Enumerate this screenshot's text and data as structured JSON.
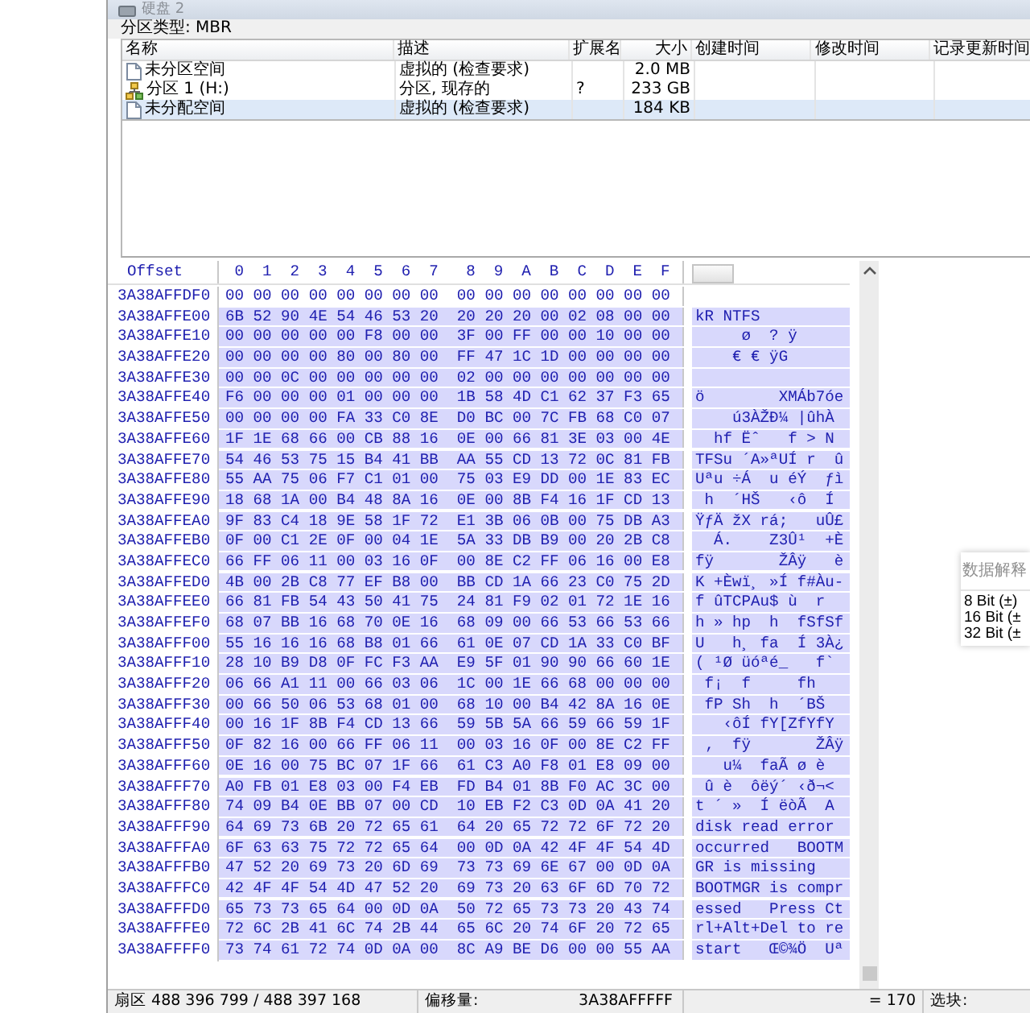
{
  "window": {
    "title": "硬盘 2"
  },
  "partition_type": "分区类型: MBR",
  "partitions": {
    "columns": [
      "名称",
      "描述",
      "扩展名",
      "大小",
      "创建时间",
      "修改时间",
      "记录更新时间"
    ],
    "rows": [
      {
        "kind": "file",
        "name": "未分区空间",
        "description": "虚拟的 (检查要求)",
        "size": "2.0 MB",
        "selected": false
      },
      {
        "kind": "partition",
        "name": "分区 1 (H:)",
        "description": "分区, 现存的",
        "extension": "?",
        "size": "233 GB",
        "selected": false
      },
      {
        "kind": "file",
        "name": "未分配空间",
        "description": "虚拟的 (检查要求)",
        "size": "184 KB",
        "selected": true
      }
    ]
  },
  "hex": {
    "offset_label": "Offset",
    "columns": [
      "0",
      "1",
      "2",
      "3",
      "4",
      "5",
      "6",
      "7",
      "8",
      "9",
      "A",
      "B",
      "C",
      "D",
      "E",
      "F"
    ],
    "rows": [
      {
        "offset": "3A38AFFDF0",
        "bytes": "00 00 00 00 00 00 00 00  00 00 00 00 00 00 00 00",
        "selected": false
      },
      {
        "offset": "3A38AFFE00",
        "bytes": "6B 52 90 4E 54 46 53 20  20 20 20 00 02 08 00 00",
        "text": "kR NTFS",
        "selected": true
      },
      {
        "offset": "3A38AFFE10",
        "bytes": "00 00 00 00 00 F8 00 00  3F 00 FF 00 00 10 00 00",
        "text": "     ø  ? ÿ",
        "selected": true
      },
      {
        "offset": "3A38AFFE20",
        "bytes": "00 00 00 00 80 00 80 00  FF 47 1C 1D 00 00 00 00",
        "text": "    € € ÿG",
        "selected": true
      },
      {
        "offset": "3A38AFFE30",
        "bytes": "00 00 0C 00 00 00 00 00  02 00 00 00 00 00 00 00",
        "selected": true
      },
      {
        "offset": "3A38AFFE40",
        "bytes": "F6 00 00 00 01 00 00 00  1B 58 4D C1 62 37 F3 65",
        "text": "ö        XMÁb7óe",
        "selected": true
      },
      {
        "offset": "3A38AFFE50",
        "bytes": "00 00 00 00 FA 33 C0 8E  D0 BC 00 7C FB 68 C0 07",
        "text": "    ú3ÀŽÐ¼ |ûhÀ",
        "selected": true
      },
      {
        "offset": "3A38AFFE60",
        "bytes": "1F 1E 68 66 00 CB 88 16  0E 00 66 81 3E 03 00 4E",
        "text": "  hf Ëˆ   f > N",
        "selected": true
      },
      {
        "offset": "3A38AFFE70",
        "bytes": "54 46 53 75 15 B4 41 BB  AA 55 CD 13 72 0C 81 FB",
        "text": "TFSu ´A»ªUÍ r  û",
        "selected": true
      },
      {
        "offset": "3A38AFFE80",
        "bytes": "55 AA 75 06 F7 C1 01 00  75 03 E9 DD 00 1E 83 EC",
        "text": "Uªu ÷Á  u éÝ  ƒì",
        "selected": true
      },
      {
        "offset": "3A38AFFE90",
        "bytes": "18 68 1A 00 B4 48 8A 16  0E 00 8B F4 16 1F CD 13",
        "text": " h  ´HŠ   ‹ô  Í",
        "selected": true
      },
      {
        "offset": "3A38AFFEA0",
        "bytes": "9F 83 C4 18 9E 58 1F 72  E1 3B 06 0B 00 75 DB A3",
        "text": "ŸƒÄ žX rá;   uÛ£",
        "selected": true
      },
      {
        "offset": "3A38AFFEB0",
        "bytes": "0F 00 C1 2E 0F 00 04 1E  5A 33 DB B9 00 20 2B C8",
        "text": "  Á.    Z3Û¹  +È",
        "selected": true
      },
      {
        "offset": "3A38AFFEC0",
        "bytes": "66 FF 06 11 00 03 16 0F  00 8E C2 FF 06 16 00 E8",
        "text": "fÿ       ŽÂÿ   è",
        "selected": true
      },
      {
        "offset": "3A38AFFED0",
        "bytes": "4B 00 2B C8 77 EF B8 00  BB CD 1A 66 23 C0 75 2D",
        "text": "K +Èwï¸ »Í f#Àu-",
        "selected": true
      },
      {
        "offset": "3A38AFFEE0",
        "bytes": "66 81 FB 54 43 50 41 75  24 81 F9 02 01 72 1E 16",
        "text": "f ûTCPAu$ ù  r",
        "selected": true
      },
      {
        "offset": "3A38AFFEF0",
        "bytes": "68 07 BB 16 68 70 0E 16  68 09 00 66 53 66 53 66",
        "text": "h » hp  h  fSfSf",
        "selected": true
      },
      {
        "offset": "3A38AFFF00",
        "bytes": "55 16 16 16 68 B8 01 66  61 0E 07 CD 1A 33 C0 BF",
        "text": "U   h¸ fa  Í 3À¿",
        "selected": true
      },
      {
        "offset": "3A38AFFF10",
        "bytes": "28 10 B9 D8 0F FC F3 AA  E9 5F 01 90 90 66 60 1E",
        "text": "( ¹Ø üóªé_   f`",
        "selected": true
      },
      {
        "offset": "3A38AFFF20",
        "bytes": "06 66 A1 11 00 66 03 06  1C 00 1E 66 68 00 00 00",
        "text": " f¡  f     fh",
        "selected": true
      },
      {
        "offset": "3A38AFFF30",
        "bytes": "00 66 50 06 53 68 01 00  68 10 00 B4 42 8A 16 0E",
        "text": " fP Sh  h  ´BŠ",
        "selected": true
      },
      {
        "offset": "3A38AFFF40",
        "bytes": "00 16 1F 8B F4 CD 13 66  59 5B 5A 66 59 66 59 1F",
        "text": "   ‹ôÍ fY[ZfYfY",
        "selected": true
      },
      {
        "offset": "3A38AFFF50",
        "bytes": "0F 82 16 00 66 FF 06 11  00 03 16 0F 00 8E C2 FF",
        "text": " ‚  fÿ       ŽÂÿ",
        "selected": true
      },
      {
        "offset": "3A38AFFF60",
        "bytes": "0E 16 00 75 BC 07 1F 66  61 C3 A0 F8 01 E8 09 00",
        "text": "   u¼  faÃ ø è",
        "selected": true
      },
      {
        "offset": "3A38AFFF70",
        "bytes": "A0 FB 01 E8 03 00 F4 EB  FD B4 01 8B F0 AC 3C 00",
        "text": " û è  ôëý´ ‹ð¬<",
        "selected": true
      },
      {
        "offset": "3A38AFFF80",
        "bytes": "74 09 B4 0E BB 07 00 CD  10 EB F2 C3 0D 0A 41 20",
        "text": "t ´ »  Í ëòÃ  A",
        "selected": true
      },
      {
        "offset": "3A38AFFF90",
        "bytes": "64 69 73 6B 20 72 65 61  64 20 65 72 72 6F 72 20",
        "text": "disk read error",
        "selected": true
      },
      {
        "offset": "3A38AFFFA0",
        "bytes": "6F 63 63 75 72 72 65 64  00 0D 0A 42 4F 4F 54 4D",
        "text": "occurred   BOOTM",
        "selected": true
      },
      {
        "offset": "3A38AFFFB0",
        "bytes": "47 52 20 69 73 20 6D 69  73 73 69 6E 67 00 0D 0A",
        "text": "GR is missing",
        "selected": true
      },
      {
        "offset": "3A38AFFFC0",
        "bytes": "42 4F 4F 54 4D 47 52 20  69 73 20 63 6F 6D 70 72",
        "text": "BOOTMGR is compr",
        "selected": true
      },
      {
        "offset": "3A38AFFFD0",
        "bytes": "65 73 73 65 64 00 0D 0A  50 72 65 73 73 20 43 74",
        "text": "essed   Press Ct",
        "selected": true
      },
      {
        "offset": "3A38AFFFE0",
        "bytes": "72 6C 2B 41 6C 74 2B 44  65 6C 20 74 6F 20 72 65",
        "text": "rl+Alt+Del to re",
        "selected": true
      },
      {
        "offset": "3A38AFFFF0",
        "bytes": "73 74 61 72 74 0D 0A 00  8C A9 BE D6 00 00 55 AA",
        "text": "start   Œ©¾Ö  Uª",
        "selected": true
      }
    ]
  },
  "interpreter": {
    "title": "数据解释",
    "items": [
      "8 Bit (±)",
      "16 Bit (±",
      "32 Bit (±"
    ]
  },
  "status_bar": {
    "sector": "扇区 488 396 799 / 488 397 168",
    "offset_label": "偏移量:",
    "offset_value": "3A38AFFFFF",
    "value": "= 170",
    "block_label": "选块:"
  }
}
